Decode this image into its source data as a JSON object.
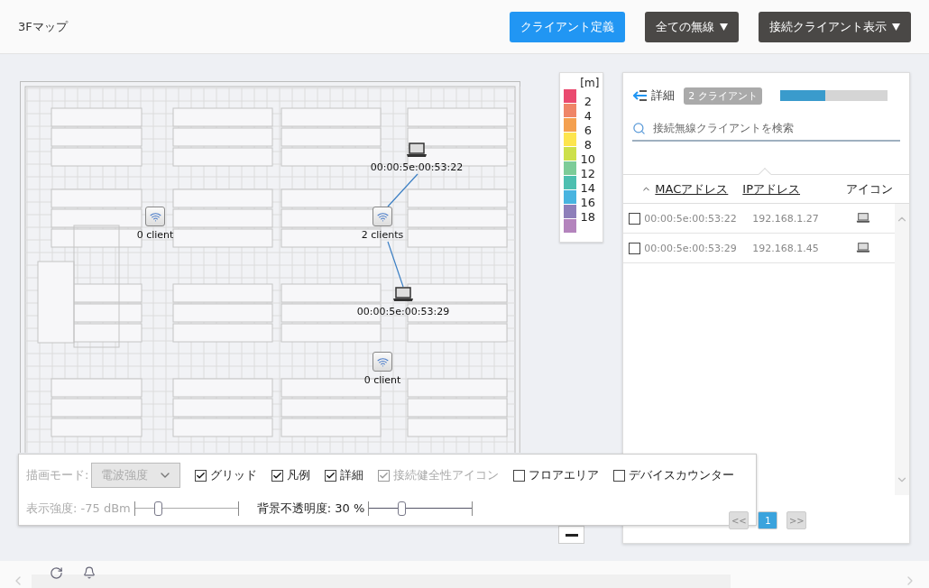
{
  "header": {
    "title": "3Fマップ",
    "buttons": [
      {
        "label": "クライアント定義",
        "kind": "primary"
      },
      {
        "label": "全ての無線",
        "kind": "dropdown"
      },
      {
        "label": "接続クライアント表示",
        "kind": "dropdown"
      }
    ]
  },
  "map": {
    "access_points": [
      {
        "label": "0 client"
      },
      {
        "label": "2 clients"
      },
      {
        "label": "0 client"
      }
    ],
    "clients": [
      {
        "label": "00:00:5e:00:53:22"
      },
      {
        "label": "00:00:5e:00:53:29"
      }
    ]
  },
  "legend": {
    "unit": "[m]",
    "items": [
      {
        "label": "2",
        "color": "#ea4a6f"
      },
      {
        "label": "4",
        "color": "#ef8567"
      },
      {
        "label": "6",
        "color": "#f4a04f"
      },
      {
        "label": "8",
        "color": "#fde54e"
      },
      {
        "label": "10",
        "color": "#cde04a"
      },
      {
        "label": "12",
        "color": "#7dcc98"
      },
      {
        "label": "14",
        "color": "#4dbfb0"
      },
      {
        "label": "16",
        "color": "#48b4e0"
      },
      {
        "label": "18",
        "color": "#8e7fba"
      },
      {
        "color": "#b484bd"
      }
    ]
  },
  "detail": {
    "title": "詳細",
    "badge": "2 クライアント",
    "progress": {
      "level": 0.42
    },
    "search": {
      "placeholder": "接続無線クライアントを検索"
    },
    "columns": [
      {
        "label": "MACアドレス",
        "sorted": true
      },
      {
        "label": "IPアドレス",
        "sorted": false
      },
      {
        "label": "アイコン",
        "sorted": false
      }
    ],
    "rows": [
      {
        "mac": "00:00:5e:00:53:22",
        "ip": "192.168.1.27",
        "checked": false
      },
      {
        "mac": "00:00:5e:00:53:29",
        "ip": "192.168.1.45",
        "checked": false
      }
    ],
    "pagination": {
      "prev": "<<",
      "pages": [
        {
          "label": "1",
          "selected": true
        }
      ],
      "next": ">>"
    }
  },
  "controls": {
    "mode_label": "描画モード:",
    "mode_value": "電波強度",
    "mode_disabled": true,
    "checkboxes": [
      {
        "label": "グリッド",
        "checked": true,
        "disabled": false
      },
      {
        "label": "凡例",
        "checked": true,
        "disabled": false
      },
      {
        "label": "詳細",
        "checked": true,
        "disabled": false
      },
      {
        "label": "接続健全性アイコン",
        "checked": true,
        "disabled": true
      },
      {
        "label": "フロアエリア",
        "checked": false,
        "disabled": false
      },
      {
        "label": "デバイスカウンター",
        "checked": false,
        "disabled": false
      }
    ],
    "sliders": [
      {
        "label": "表示強度: -75 dBm",
        "level": 0.22,
        "disabled": true
      },
      {
        "label": "背景不透明度: 30 %",
        "level": 0.31,
        "disabled": false
      }
    ]
  }
}
